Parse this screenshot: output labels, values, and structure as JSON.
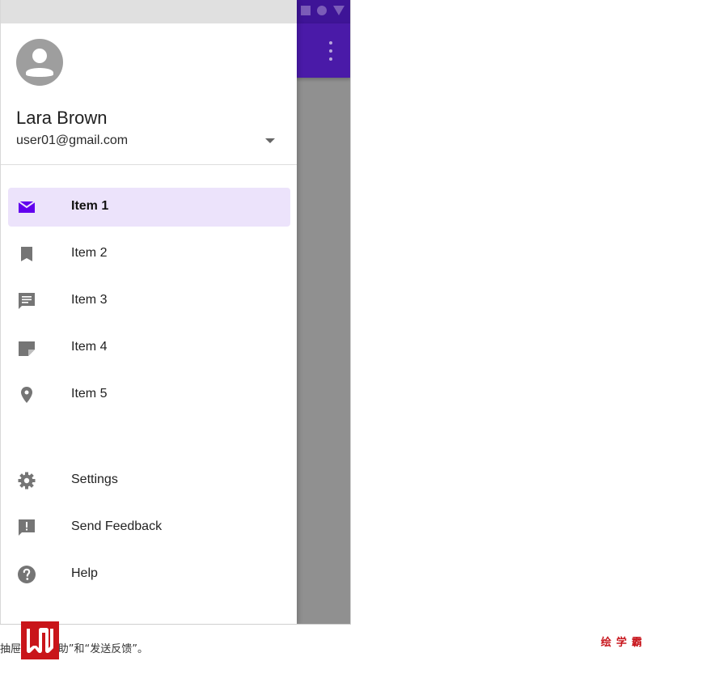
{
  "account": {
    "name": "Lara Brown",
    "email": "user01@gmail.com"
  },
  "nav": {
    "primary": [
      {
        "label": "Item 1",
        "icon": "mail-icon",
        "active": true
      },
      {
        "label": "Item 2",
        "icon": "bookmark-icon",
        "active": false
      },
      {
        "label": "Item 3",
        "icon": "chat-icon",
        "active": false
      },
      {
        "label": "Item 4",
        "icon": "note-icon",
        "active": false
      },
      {
        "label": "Item 5",
        "icon": "location-pin-icon",
        "active": false
      }
    ],
    "secondary": [
      {
        "label": "Settings",
        "icon": "gear-icon"
      },
      {
        "label": "Send Feedback",
        "icon": "feedback-icon"
      },
      {
        "label": "Help",
        "icon": "help-icon"
      }
    ]
  },
  "caption": {
    "text": "抽屉中的“帮助”和“发送反馈”。"
  },
  "watermark": {
    "text": "绘学霸"
  },
  "colors": {
    "app_bar": "#4a1aa8",
    "accent": "#6200ee",
    "active_item_bg": "#ece3fb",
    "icon_gray": "#757575",
    "scrim": "#909090",
    "brand_red": "#c9151a"
  }
}
